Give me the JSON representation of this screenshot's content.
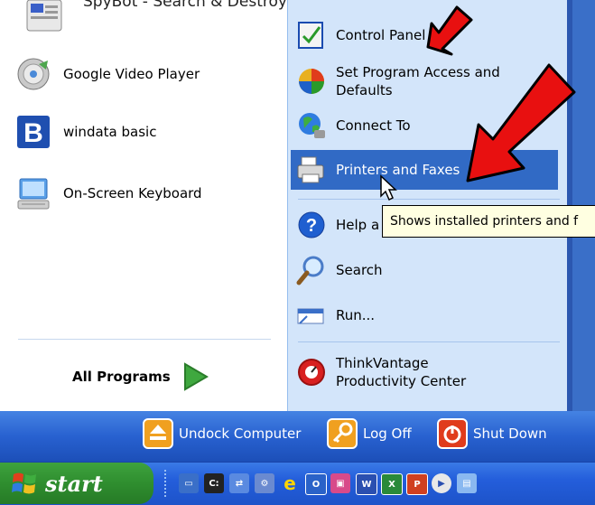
{
  "left_items": [
    {
      "label": "SpyBot - Search & Destroy",
      "icon": "spybot-icon"
    },
    {
      "label": "Google Video Player",
      "icon": "google-video-player-icon"
    },
    {
      "label": "windata basic",
      "icon": "windata-icon"
    },
    {
      "label": "On-Screen Keyboard",
      "icon": "keyboard-icon"
    }
  ],
  "all_programs": {
    "label": "All Programs",
    "icon": "green-arrow-icon"
  },
  "right_items": [
    {
      "label": "Control Panel",
      "icon": "control-panel-icon"
    },
    {
      "label": "Set Program Access and Defaults",
      "icon": "program-access-icon"
    },
    {
      "label": "Connect To",
      "icon": "connect-to-icon"
    },
    {
      "label": "Printers and Faxes",
      "icon": "printer-icon"
    },
    {
      "label": "Help a",
      "icon": "help-icon"
    },
    {
      "label": "Search",
      "icon": "search-icon"
    },
    {
      "label": "Run...",
      "icon": "run-icon"
    },
    {
      "label": "ThinkVantage Productivity Center",
      "icon": "thinkvantage-icon"
    }
  ],
  "tooltip": "Shows installed printers and f",
  "bottom_bar": {
    "undock": "Undock Computer",
    "logoff": "Log Off",
    "shutdown": "Shut Down"
  },
  "taskbar": {
    "start": "start",
    "quick_launch": [
      "show-desktop-icon",
      "cmd-icon",
      "network-icon",
      "gear-icon",
      "ie-icon",
      "outlook-icon",
      "picture-icon",
      "word-icon",
      "excel-icon",
      "powerpoint-icon",
      "media-icon",
      "folder-icon"
    ]
  },
  "colors": {
    "highlight": "#316ac5",
    "arrow": "#e81010",
    "start_green": "#2f8e2f"
  }
}
